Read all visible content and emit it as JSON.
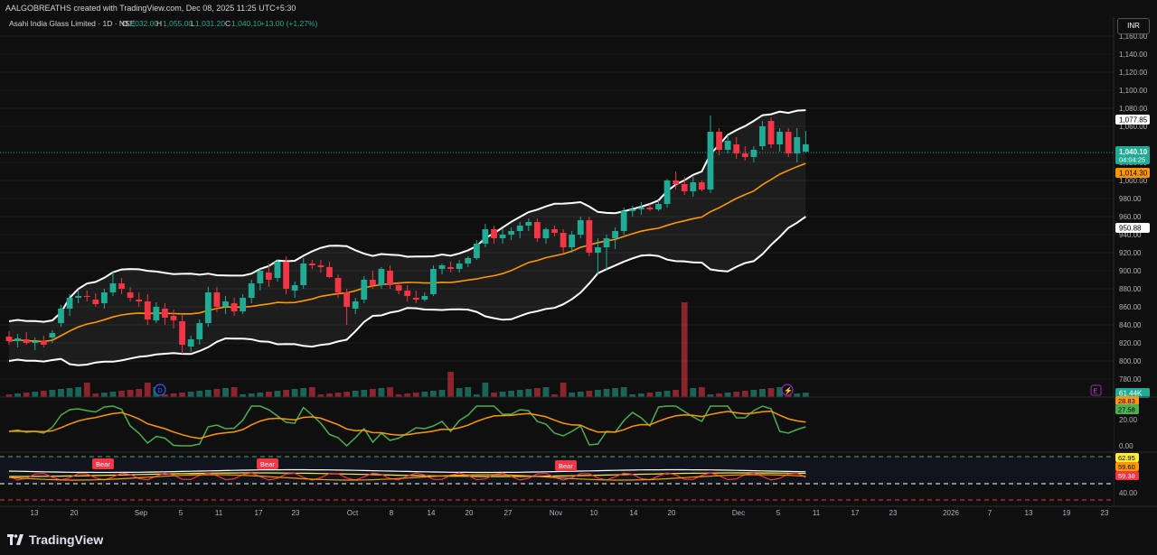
{
  "header": {
    "caption": "AALGOBREATHS created with TradingView.com, Dec 08, 2025 11:25 UTC+5:30"
  },
  "symbol": {
    "name": "Asahi India Glass Limited · 1D · NSE",
    "o_label": "O",
    "o": "1,032.00",
    "h_label": "H",
    "h": "1,055.00",
    "l_label": "L",
    "l": "1,031.20",
    "c_label": "C",
    "c": "1,040.10",
    "change": "+13.00 (+1.27%)"
  },
  "currency_button": "INR",
  "price_axis": {
    "ticks": [
      "1,160.00",
      "1,140.00",
      "1,120.00",
      "1,100.00",
      "1,080.00",
      "1,060.00",
      "1,020.00",
      "1,000.00",
      "980.00",
      "960.00",
      "940.00",
      "920.00",
      "900.00",
      "880.00",
      "860.00",
      "840.00",
      "820.00",
      "800.00",
      "780.00"
    ],
    "badges": {
      "bb_upper": "1,077.85",
      "last_price": "1,040.10",
      "countdown": "04:04:25",
      "bb_basis": "1,014.30",
      "bb_lower": "950.88",
      "volume": "61.44K"
    }
  },
  "osc1": {
    "ticks": [
      "20.00",
      "0.00"
    ],
    "badges": {
      "green": "27.58",
      "orange": "28.83"
    }
  },
  "osc2": {
    "ticks": [
      "40.00"
    ],
    "badges": {
      "yellow": "62.95",
      "orange": "59.60",
      "red": "59.38"
    },
    "signals": [
      "Bear",
      "Bear",
      "Bear"
    ]
  },
  "time_axis": [
    "13",
    "20",
    "Sep",
    "5",
    "11",
    "17",
    "23",
    "Oct",
    "8",
    "14",
    "20",
    "27",
    "Nov",
    "10",
    "14",
    "20",
    "Dec",
    "5",
    "11",
    "17",
    "23",
    "2026",
    "7",
    "13",
    "19",
    "23"
  ],
  "markers": {
    "dividend": "D",
    "earnings": "⚡",
    "event": "E"
  },
  "brand": "TradingView",
  "colors": {
    "bg": "#0f0f0f",
    "up": "#22ab94",
    "down": "#f23645",
    "band": "#ffffff",
    "basis": "#ff9800",
    "green_line": "#4caf50",
    "grid": "#1c1c1c"
  },
  "chart_data": {
    "type": "candlestick",
    "title": "Asahi India Glass Limited · 1D · NSE",
    "ylim": [
      760,
      1180
    ],
    "candles": [
      {
        "o": 827,
        "h": 833,
        "l": 818,
        "c": 822
      },
      {
        "o": 822,
        "h": 830,
        "l": 815,
        "c": 825
      },
      {
        "o": 824,
        "h": 832,
        "l": 818,
        "c": 820
      },
      {
        "o": 820,
        "h": 826,
        "l": 812,
        "c": 822
      },
      {
        "o": 822,
        "h": 828,
        "l": 815,
        "c": 818
      },
      {
        "o": 826,
        "h": 834,
        "l": 820,
        "c": 831
      },
      {
        "o": 842,
        "h": 862,
        "l": 838,
        "c": 858
      },
      {
        "o": 858,
        "h": 874,
        "l": 850,
        "c": 870
      },
      {
        "o": 870,
        "h": 878,
        "l": 864,
        "c": 872
      },
      {
        "o": 872,
        "h": 878,
        "l": 866,
        "c": 871
      },
      {
        "o": 868,
        "h": 875,
        "l": 860,
        "c": 863
      },
      {
        "o": 864,
        "h": 880,
        "l": 858,
        "c": 876
      },
      {
        "o": 876,
        "h": 900,
        "l": 872,
        "c": 886
      },
      {
        "o": 886,
        "h": 892,
        "l": 874,
        "c": 880
      },
      {
        "o": 876,
        "h": 882,
        "l": 866,
        "c": 870
      },
      {
        "o": 868,
        "h": 876,
        "l": 860,
        "c": 866
      },
      {
        "o": 866,
        "h": 874,
        "l": 840,
        "c": 846
      },
      {
        "o": 845,
        "h": 865,
        "l": 842,
        "c": 860
      },
      {
        "o": 858,
        "h": 864,
        "l": 840,
        "c": 848
      },
      {
        "o": 850,
        "h": 857,
        "l": 836,
        "c": 845
      },
      {
        "o": 844,
        "h": 852,
        "l": 808,
        "c": 818
      },
      {
        "o": 816,
        "h": 828,
        "l": 810,
        "c": 824
      },
      {
        "o": 824,
        "h": 846,
        "l": 818,
        "c": 842
      },
      {
        "o": 842,
        "h": 882,
        "l": 838,
        "c": 876
      },
      {
        "o": 876,
        "h": 882,
        "l": 854,
        "c": 860
      },
      {
        "o": 860,
        "h": 872,
        "l": 852,
        "c": 866
      },
      {
        "o": 864,
        "h": 870,
        "l": 850,
        "c": 855
      },
      {
        "o": 855,
        "h": 874,
        "l": 852,
        "c": 870
      },
      {
        "o": 870,
        "h": 890,
        "l": 864,
        "c": 886
      },
      {
        "o": 886,
        "h": 902,
        "l": 878,
        "c": 900
      },
      {
        "o": 898,
        "h": 908,
        "l": 882,
        "c": 890
      },
      {
        "o": 892,
        "h": 912,
        "l": 888,
        "c": 910
      },
      {
        "o": 910,
        "h": 916,
        "l": 874,
        "c": 880
      },
      {
        "o": 878,
        "h": 888,
        "l": 870,
        "c": 884
      },
      {
        "o": 884,
        "h": 914,
        "l": 880,
        "c": 908
      },
      {
        "o": 908,
        "h": 912,
        "l": 902,
        "c": 906
      },
      {
        "o": 906,
        "h": 912,
        "l": 898,
        "c": 904
      },
      {
        "o": 904,
        "h": 910,
        "l": 892,
        "c": 893
      },
      {
        "o": 892,
        "h": 896,
        "l": 870,
        "c": 876
      },
      {
        "o": 876,
        "h": 880,
        "l": 840,
        "c": 860
      },
      {
        "o": 858,
        "h": 870,
        "l": 852,
        "c": 866
      },
      {
        "o": 868,
        "h": 894,
        "l": 864,
        "c": 890
      },
      {
        "o": 890,
        "h": 900,
        "l": 880,
        "c": 884
      },
      {
        "o": 884,
        "h": 904,
        "l": 880,
        "c": 902
      },
      {
        "o": 900,
        "h": 906,
        "l": 880,
        "c": 884
      },
      {
        "o": 884,
        "h": 888,
        "l": 874,
        "c": 878
      },
      {
        "o": 878,
        "h": 884,
        "l": 866,
        "c": 872
      },
      {
        "o": 870,
        "h": 878,
        "l": 864,
        "c": 868
      },
      {
        "o": 868,
        "h": 876,
        "l": 866,
        "c": 872
      },
      {
        "o": 874,
        "h": 906,
        "l": 872,
        "c": 902
      },
      {
        "o": 902,
        "h": 908,
        "l": 896,
        "c": 906
      },
      {
        "o": 904,
        "h": 910,
        "l": 898,
        "c": 902
      },
      {
        "o": 902,
        "h": 912,
        "l": 898,
        "c": 908
      },
      {
        "o": 908,
        "h": 916,
        "l": 904,
        "c": 914
      },
      {
        "o": 914,
        "h": 934,
        "l": 912,
        "c": 930
      },
      {
        "o": 930,
        "h": 952,
        "l": 926,
        "c": 946
      },
      {
        "o": 946,
        "h": 950,
        "l": 930,
        "c": 936
      },
      {
        "o": 936,
        "h": 946,
        "l": 930,
        "c": 940
      },
      {
        "o": 940,
        "h": 948,
        "l": 934,
        "c": 944
      },
      {
        "o": 944,
        "h": 954,
        "l": 936,
        "c": 950
      },
      {
        "o": 950,
        "h": 958,
        "l": 944,
        "c": 954
      },
      {
        "o": 954,
        "h": 958,
        "l": 932,
        "c": 936
      },
      {
        "o": 936,
        "h": 948,
        "l": 930,
        "c": 946
      },
      {
        "o": 946,
        "h": 950,
        "l": 938,
        "c": 942
      },
      {
        "o": 942,
        "h": 946,
        "l": 920,
        "c": 926
      },
      {
        "o": 926,
        "h": 944,
        "l": 920,
        "c": 940
      },
      {
        "o": 940,
        "h": 960,
        "l": 936,
        "c": 956
      },
      {
        "o": 956,
        "h": 960,
        "l": 916,
        "c": 920
      },
      {
        "o": 920,
        "h": 936,
        "l": 896,
        "c": 926
      },
      {
        "o": 926,
        "h": 940,
        "l": 900,
        "c": 936
      },
      {
        "o": 936,
        "h": 948,
        "l": 924,
        "c": 944
      },
      {
        "o": 944,
        "h": 970,
        "l": 940,
        "c": 966
      },
      {
        "o": 966,
        "h": 972,
        "l": 960,
        "c": 968
      },
      {
        "o": 968,
        "h": 976,
        "l": 962,
        "c": 970
      },
      {
        "o": 970,
        "h": 974,
        "l": 966,
        "c": 968
      },
      {
        "o": 968,
        "h": 978,
        "l": 966,
        "c": 974
      },
      {
        "o": 974,
        "h": 1002,
        "l": 970,
        "c": 1000
      },
      {
        "o": 1000,
        "h": 1010,
        "l": 990,
        "c": 996
      },
      {
        "o": 996,
        "h": 1004,
        "l": 984,
        "c": 988
      },
      {
        "o": 988,
        "h": 1004,
        "l": 982,
        "c": 998
      },
      {
        "o": 998,
        "h": 1000,
        "l": 988,
        "c": 990
      },
      {
        "o": 990,
        "h": 1072,
        "l": 986,
        "c": 1054
      },
      {
        "o": 1054,
        "h": 1058,
        "l": 1028,
        "c": 1034
      },
      {
        "o": 1034,
        "h": 1050,
        "l": 1030,
        "c": 1044
      },
      {
        "o": 1040,
        "h": 1048,
        "l": 1024,
        "c": 1030
      },
      {
        "o": 1030,
        "h": 1038,
        "l": 1022,
        "c": 1026
      },
      {
        "o": 1026,
        "h": 1038,
        "l": 1020,
        "c": 1034
      },
      {
        "o": 1038,
        "h": 1066,
        "l": 1034,
        "c": 1060
      },
      {
        "o": 1066,
        "h": 1070,
        "l": 1036,
        "c": 1040
      },
      {
        "o": 1040,
        "h": 1058,
        "l": 1032,
        "c": 1054
      },
      {
        "o": 1054,
        "h": 1058,
        "l": 1026,
        "c": 1030
      },
      {
        "o": 1030,
        "h": 1058,
        "l": 1020,
        "c": 1048
      },
      {
        "o": 1032,
        "h": 1055,
        "l": 1031.2,
        "c": 1040.1
      }
    ]
  }
}
